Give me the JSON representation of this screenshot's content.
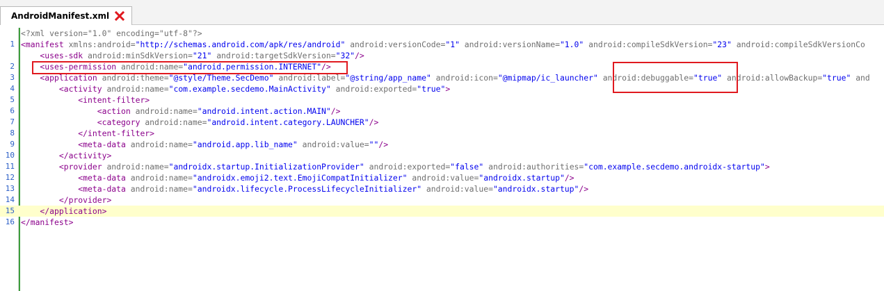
{
  "tab": {
    "title": "AndroidManifest.xml",
    "close_icon": "close-icon",
    "close_color": "#e0191f"
  },
  "colors": {
    "tag": "#8b008b",
    "attr": "#6e6e6e",
    "value": "#0000ee",
    "line_number": "#2b5ec7",
    "current_line": "#ffffcc",
    "highlight_box": "#e0191f"
  },
  "lines": [
    {
      "num": "",
      "tokens": [
        {
          "t": "decl",
          "s": "<?xml version=\"1.0\" encoding=\"utf-8\"?>"
        }
      ]
    },
    {
      "num": "1",
      "tokens": [
        {
          "t": "tag",
          "s": "<manifest "
        },
        {
          "t": "attr",
          "s": "xmlns:android="
        },
        {
          "t": "val",
          "s": "\"http://schemas.android.com/apk/res/android\" "
        },
        {
          "t": "attr",
          "s": "android:versionCode="
        },
        {
          "t": "val",
          "s": "\"1\" "
        },
        {
          "t": "attr",
          "s": "android:versionName="
        },
        {
          "t": "val",
          "s": "\"1.0\" "
        },
        {
          "t": "attr",
          "s": "android:compileSdkVersion="
        },
        {
          "t": "val",
          "s": "\"23\" "
        },
        {
          "t": "attr",
          "s": "android:compileSdkVersionCo"
        }
      ]
    },
    {
      "num": "",
      "tokens": [
        {
          "t": "tag",
          "s": "    <uses-sdk "
        },
        {
          "t": "attr",
          "s": "android:minSdkVersion="
        },
        {
          "t": "val",
          "s": "\"21\" "
        },
        {
          "t": "attr",
          "s": "android:targetSdkVersion="
        },
        {
          "t": "val",
          "s": "\"32\""
        },
        {
          "t": "tag",
          "s": "/>"
        }
      ]
    },
    {
      "num": "2",
      "tokens": [
        {
          "t": "tag",
          "s": "    <uses-permission "
        },
        {
          "t": "attr",
          "s": "android:name="
        },
        {
          "t": "val",
          "s": "\"android.permission.INTERNET\""
        },
        {
          "t": "tag",
          "s": "/>"
        }
      ]
    },
    {
      "num": "3",
      "tokens": [
        {
          "t": "tag",
          "s": "    <application "
        },
        {
          "t": "attr",
          "s": "android:theme="
        },
        {
          "t": "val",
          "s": "\"@style/Theme.SecDemo\" "
        },
        {
          "t": "attr",
          "s": "android:label="
        },
        {
          "t": "val",
          "s": "\"@string/app_name\" "
        },
        {
          "t": "attr",
          "s": "android:icon="
        },
        {
          "t": "val",
          "s": "\"@mipmap/ic_launcher\" "
        },
        {
          "t": "attr",
          "s": "android:debuggable="
        },
        {
          "t": "val",
          "s": "\"true\" "
        },
        {
          "t": "attr",
          "s": "android:allowBackup="
        },
        {
          "t": "val",
          "s": "\"true\" "
        },
        {
          "t": "attr",
          "s": "and"
        }
      ]
    },
    {
      "num": "4",
      "tokens": [
        {
          "t": "tag",
          "s": "        <activity "
        },
        {
          "t": "attr",
          "s": "android:name="
        },
        {
          "t": "val",
          "s": "\"com.example.secdemo.MainActivity\" "
        },
        {
          "t": "attr",
          "s": "android:exported="
        },
        {
          "t": "val",
          "s": "\"true\""
        },
        {
          "t": "tag",
          "s": ">"
        }
      ]
    },
    {
      "num": "5",
      "tokens": [
        {
          "t": "tag",
          "s": "            <intent-filter>"
        }
      ]
    },
    {
      "num": "6",
      "tokens": [
        {
          "t": "tag",
          "s": "                <action "
        },
        {
          "t": "attr",
          "s": "android:name="
        },
        {
          "t": "val",
          "s": "\"android.intent.action.MAIN\""
        },
        {
          "t": "tag",
          "s": "/>"
        }
      ]
    },
    {
      "num": "7",
      "tokens": [
        {
          "t": "tag",
          "s": "                <category "
        },
        {
          "t": "attr",
          "s": "android:name="
        },
        {
          "t": "val",
          "s": "\"android.intent.category.LAUNCHER\""
        },
        {
          "t": "tag",
          "s": "/>"
        }
      ]
    },
    {
      "num": "8",
      "tokens": [
        {
          "t": "tag",
          "s": "            </intent-filter>"
        }
      ]
    },
    {
      "num": "9",
      "tokens": [
        {
          "t": "tag",
          "s": "            <meta-data "
        },
        {
          "t": "attr",
          "s": "android:name="
        },
        {
          "t": "val",
          "s": "\"android.app.lib_name\" "
        },
        {
          "t": "attr",
          "s": "android:value="
        },
        {
          "t": "val",
          "s": "\"\""
        },
        {
          "t": "tag",
          "s": "/>"
        }
      ]
    },
    {
      "num": "10",
      "tokens": [
        {
          "t": "tag",
          "s": "        </activity>"
        }
      ]
    },
    {
      "num": "11",
      "tokens": [
        {
          "t": "tag",
          "s": "        <provider "
        },
        {
          "t": "attr",
          "s": "android:name="
        },
        {
          "t": "val",
          "s": "\"androidx.startup.InitializationProvider\" "
        },
        {
          "t": "attr",
          "s": "android:exported="
        },
        {
          "t": "val",
          "s": "\"false\" "
        },
        {
          "t": "attr",
          "s": "android:authorities="
        },
        {
          "t": "val",
          "s": "\"com.example.secdemo.androidx-startup\""
        },
        {
          "t": "tag",
          "s": ">"
        }
      ]
    },
    {
      "num": "12",
      "tokens": [
        {
          "t": "tag",
          "s": "            <meta-data "
        },
        {
          "t": "attr",
          "s": "android:name="
        },
        {
          "t": "val",
          "s": "\"androidx.emoji2.text.EmojiCompatInitializer\" "
        },
        {
          "t": "attr",
          "s": "android:value="
        },
        {
          "t": "val",
          "s": "\"androidx.startup\""
        },
        {
          "t": "tag",
          "s": "/>"
        }
      ]
    },
    {
      "num": "13",
      "tokens": [
        {
          "t": "tag",
          "s": "            <meta-data "
        },
        {
          "t": "attr",
          "s": "android:name="
        },
        {
          "t": "val",
          "s": "\"androidx.lifecycle.ProcessLifecycleInitializer\" "
        },
        {
          "t": "attr",
          "s": "android:value="
        },
        {
          "t": "val",
          "s": "\"androidx.startup\""
        },
        {
          "t": "tag",
          "s": "/>"
        }
      ]
    },
    {
      "num": "14",
      "tokens": [
        {
          "t": "tag",
          "s": "        </provider>"
        }
      ]
    },
    {
      "num": "15",
      "current": true,
      "tokens": [
        {
          "t": "tag",
          "s": "    </application>"
        }
      ]
    },
    {
      "num": "16",
      "tokens": [
        {
          "t": "tag",
          "s": "</manifest>"
        }
      ]
    }
  ]
}
